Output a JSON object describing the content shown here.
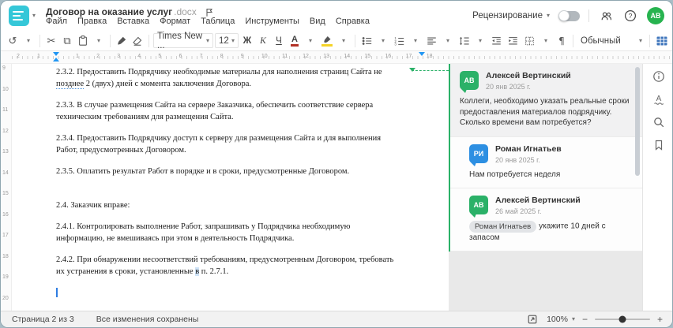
{
  "window": {
    "title": "Договор на оказание услуг",
    "title_ext": ".docx"
  },
  "menu": [
    "Файл",
    "Правка",
    "Вставка",
    "Формат",
    "Таблица",
    "Инструменты",
    "Вид",
    "Справка"
  ],
  "header": {
    "review_label": "Рецензирование",
    "avatar_initials": "АВ"
  },
  "toolbar": {
    "font_name": "Times New ...",
    "font_size": "12",
    "bold": "Ж",
    "italic": "К",
    "underline": "Ч",
    "font_color": "А",
    "style_name": "Обычный",
    "paragraph_mark": "¶",
    "more": "•••"
  },
  "glyphs": {
    "caret": "▾",
    "undo": "↺",
    "scissors": "✂",
    "copy": "⧉"
  },
  "colors": {
    "logo_teal": "#35c7d8",
    "comment_green": "#2bb168",
    "comment_blue": "#2d8fe2",
    "toolbar_blue": "#3f76bc",
    "highlight_yellow": "#f5d327",
    "ruler_marker_blue": "#2196f3"
  },
  "ruler_h": {
    "left_numbers": [
      "2",
      "1"
    ],
    "numbers": [
      "1",
      "2",
      "3",
      "4",
      "5",
      "6",
      "7",
      "8",
      "9",
      "10",
      "11",
      "12",
      "13",
      "14",
      "15",
      "16",
      "17",
      "18"
    ]
  },
  "ruler_v": {
    "numbers": [
      "9",
      "10",
      "11",
      "12",
      "13",
      "14",
      "15",
      "16",
      "17",
      "18",
      "19",
      "20"
    ]
  },
  "document": {
    "paragraphs": [
      {
        "lines": [
          [
            {
              "t": "2.3.2. Предоставить Подрядчику необходимые материалы для наполнения страниц Сайта не"
            }
          ],
          [
            {
              "t": "позднее",
              "cls": "spell"
            },
            {
              "t": " 2 (двух) дней с момента заключения Договора."
            }
          ]
        ]
      },
      {
        "lines": [
          [
            {
              "t": "2.3.3. В случае размещения Сайта на сервере Заказчика, обеспечить соответствие сервера"
            }
          ],
          [
            {
              "t": "техническим требованиям для размещения Сайта."
            }
          ]
        ]
      },
      {
        "lines": [
          [
            {
              "t": "2.3.4. Предоставить Подрядчику доступ к серверу для размещения Сайта и для выполнения"
            }
          ],
          [
            {
              "t": "Работ, предусмотренных Договором."
            }
          ]
        ]
      },
      {
        "lines": [
          [
            {
              "t": "2.3.5. Оплатить результат Работ в порядке и в сроки, предусмотренные Договором."
            }
          ]
        ]
      },
      {
        "gap_before": true,
        "lines": [
          [
            {
              "t": "2.4. Заказчик вправе:"
            }
          ]
        ]
      },
      {
        "lines": [
          [
            {
              "t": "2.4.1. Контролировать выполнение Работ, запрашивать у Подрядчика необходимую"
            }
          ],
          [
            {
              "t": "информацию, не вмешиваясь при этом в деятельность Подрядчика."
            }
          ]
        ]
      },
      {
        "lines": [
          [
            {
              "t": "2.4.2. При обнаружении несоответствий требованиям, предусмотренным Договором, требовать"
            }
          ],
          [
            {
              "t": "их устранения в сроки, установленные "
            },
            {
              "t": "в",
              "cls": "hl"
            },
            {
              "t": " п. 2.7.1."
            }
          ]
        ]
      }
    ]
  },
  "comments": [
    {
      "initials": "АВ",
      "color": "#2bb168",
      "name": "Алексей Вертинский",
      "date": "20 янв 2025 г.",
      "text": "Коллеги, необходимо указать реальные сроки предоставления материалов подрядчику. Сколько времени вам потребуется?",
      "selected": true,
      "reply": false
    },
    {
      "initials": "РИ",
      "color": "#2d8fe2",
      "name": "Роман Игнатьев",
      "date": "20 янв 2025 г.",
      "text": "Нам потребуется неделя",
      "selected": false,
      "reply": true
    },
    {
      "initials": "АВ",
      "color": "#2bb168",
      "name": "Алексей Вертинский",
      "date": "26 май 2025 г.",
      "mention": "Роман Игнатьев",
      "text": "укажите 10 дней с запасом",
      "selected": false,
      "reply": true
    }
  ],
  "status_bar": {
    "page_info": "Страница 2 из 3",
    "saved_status": "Все изменения сохранены",
    "zoom_level": "100%",
    "zoom_out": "−",
    "zoom_in": "+"
  }
}
